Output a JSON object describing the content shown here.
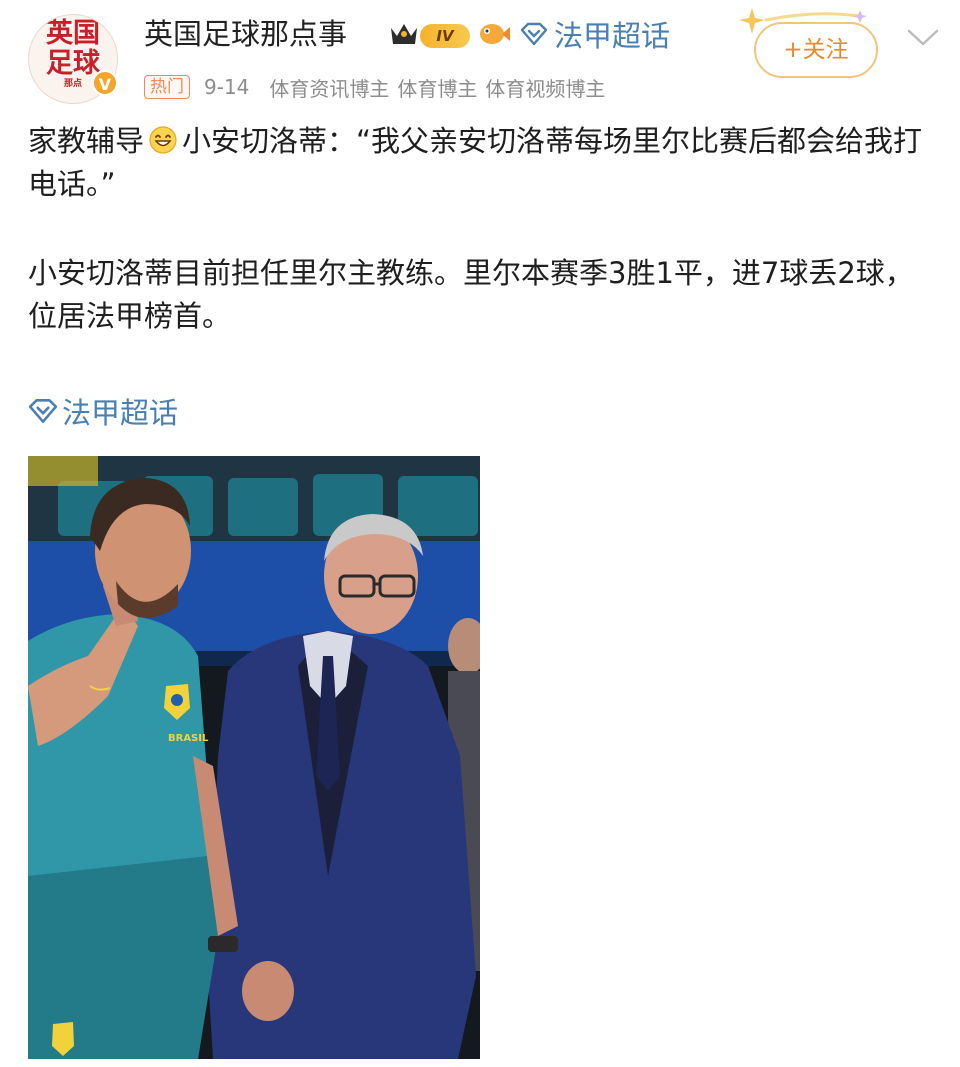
{
  "header": {
    "avatar_text_line1": "英国",
    "avatar_text_line2": "足球",
    "avatar_text_small": "那点",
    "verified_badge": "V",
    "username": "英国足球那点事",
    "level_badge": "IV",
    "topic": "法甲超话",
    "follow_label": "+关注"
  },
  "meta": {
    "hot_tag": "热门",
    "date": "9-14",
    "roles": [
      "体育资讯博主",
      "体育博主",
      "体育视频博主"
    ]
  },
  "post": {
    "line1_prefix": "家教辅导",
    "line1_rest": "小安切洛蒂：“我父亲安切洛蒂每场里尔比赛后都会给我打电话。”",
    "para2": "小安切洛蒂目前担任里尔主教练。里尔本赛季3胜1平，进7球丢2球，位居法甲榜首。",
    "topic_link": "法甲超话"
  },
  "photo": {
    "jersey_text": "BRASIL"
  },
  "icons": {
    "crown": "crown-icon",
    "fish": "fish-icon",
    "topic": "diamond-topic-icon",
    "grin": "grinning-emoji-icon",
    "chevron": "chevron-down-icon",
    "sparkle": "sparkle-icon"
  },
  "colors": {
    "link_blue": "#4a7fb3",
    "follow_orange": "#e8892f",
    "hot_orange": "#f08a5a",
    "level_gold": "#f5b22e"
  }
}
